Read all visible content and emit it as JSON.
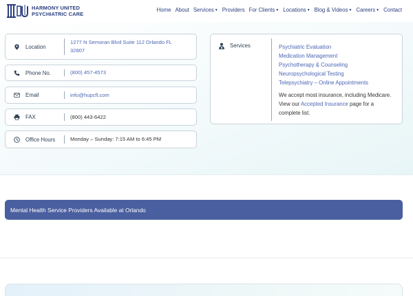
{
  "brand": {
    "line1": "HARMONY UNITED",
    "line2": "PSYCHIATRIC CARE",
    "color": "#2c3f7e"
  },
  "nav": [
    {
      "label": "Home",
      "dropdown": false
    },
    {
      "label": "About",
      "dropdown": false
    },
    {
      "label": "Services",
      "dropdown": true
    },
    {
      "label": "Providers",
      "dropdown": false
    },
    {
      "label": "For Clients",
      "dropdown": true
    },
    {
      "label": "Locations",
      "dropdown": true
    },
    {
      "label": "Blog & Videos",
      "dropdown": true
    },
    {
      "label": "Careers",
      "dropdown": true
    },
    {
      "label": "Contact",
      "dropdown": false
    }
  ],
  "info": {
    "location": {
      "label": "Location",
      "value_line1": "1277 N Semoran Blvd Suite 112 Orlando FL",
      "value_line2": "32807",
      "icon": "map-pin-icon"
    },
    "phone": {
      "label": "Phone No.",
      "value": "(800) 457-4573",
      "icon": "phone-icon"
    },
    "email": {
      "label": "Email",
      "value": "info@hupcfl.com",
      "icon": "envelope-icon"
    },
    "fax": {
      "label": "FAX",
      "value": "(800) 443-6422",
      "icon": "printer-icon"
    },
    "hours": {
      "label": "Office Hours",
      "value": "Monday – Sunday: 7:15 AM to 6:45 PM",
      "icon": "clock-icon"
    }
  },
  "services": {
    "label": "Services",
    "icon": "user-doctor-icon",
    "items": [
      "Psychiatric Evaluation",
      "Medication Management",
      "Psychotherapy & Counseling",
      "Neuropsychological Testing",
      "Telepsychiatry – Online Appointments"
    ],
    "note_before": "We accept most insurance, including Medicare. View our ",
    "note_link": "Accepted Insurance",
    "note_after": " page for a complete list."
  },
  "banner": {
    "text": "Mental Health Service Providers Available at  Orlando"
  },
  "colors": {
    "link": "#4c66b4",
    "banner_bg": "#4a5f9f",
    "label": "#2c3f54"
  }
}
